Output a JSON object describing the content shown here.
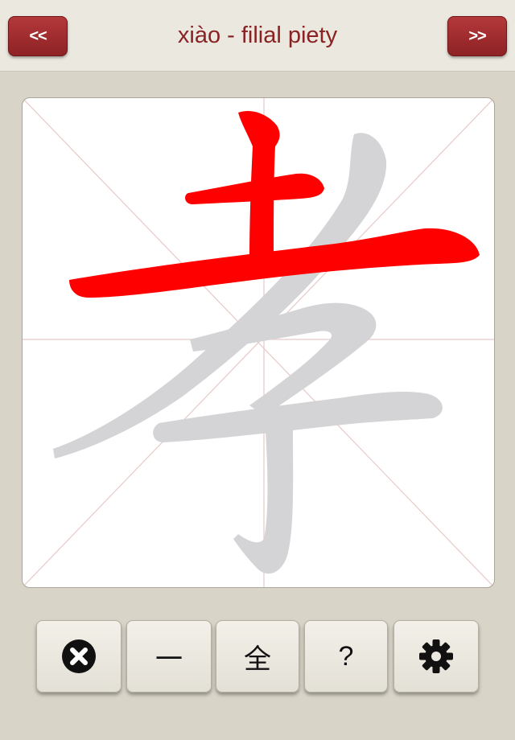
{
  "header": {
    "prev_label": "<<",
    "next_label": ">>",
    "title": "xiào - filial piety"
  },
  "canvas": {
    "character": "孝",
    "stroke_active_color": "#ff0000",
    "stroke_inactive_color": "#d4d4d6",
    "guide_color": "#e8c9c9"
  },
  "toolbar": {
    "clear_icon": "close-circle-icon",
    "stroke_label": "一",
    "full_label": "全",
    "help_label": "?",
    "settings_icon": "gear-icon"
  }
}
